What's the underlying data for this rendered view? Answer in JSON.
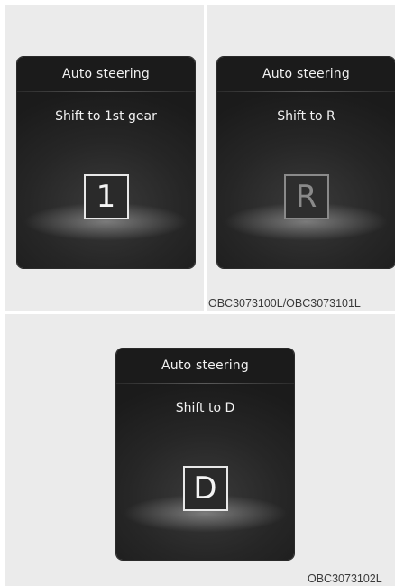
{
  "panels": [
    {
      "title": "Auto steering",
      "message": "Shift to 1st gear",
      "gear": "1",
      "gear_state": "active"
    },
    {
      "title": "Auto steering",
      "message": "Shift to R",
      "gear": "R",
      "gear_state": "dimmed"
    },
    {
      "title": "Auto steering",
      "message": "Shift to D",
      "gear": "D",
      "gear_state": "active"
    }
  ],
  "captions": {
    "top": "OBC3073100L/OBC3073101L",
    "bottom": "OBC3073102L"
  },
  "colors": {
    "page_background": "#ebebeb",
    "screen_background": "#1b1b1b",
    "text": "#f2f2f2",
    "gear_dimmed": "#8a8a8a"
  }
}
